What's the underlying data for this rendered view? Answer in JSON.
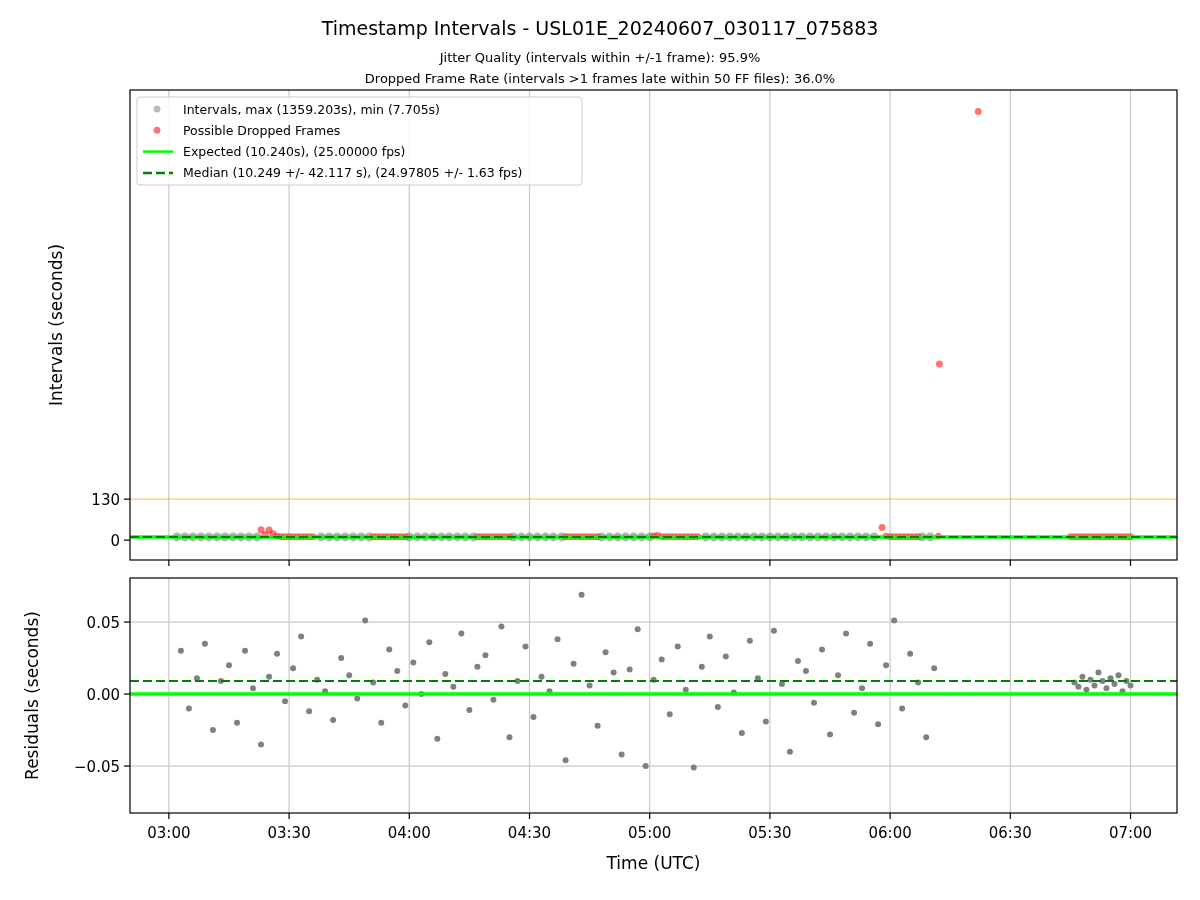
{
  "figure": {
    "title": "Timestamp Intervals - USL01E_20240607_030117_075883",
    "subtitles": [
      "Jitter Quality (intervals within +/-1 frame): 95.9%",
      "Dropped Frame Rate (intervals >1 frames late within 50 FF files): 36.0%"
    ]
  },
  "intervals_plot": {
    "chart_data": {
      "type": "scatter",
      "ylabel": "Intervals (seconds)",
      "xlim": [
        170.3,
        431.6
      ],
      "ylim": [
        -63,
        1427
      ],
      "yticks": [
        {
          "value": 0,
          "label": "0"
        },
        {
          "value": 130,
          "label": "130"
        }
      ],
      "series": [
        {
          "name": "Intervals, max (1359.203s), min (7.705s)",
          "type": "scatter",
          "color": "#808080",
          "x": [
            182,
            184,
            186,
            188,
            190,
            192,
            194,
            196,
            198,
            200,
            202,
            218,
            220,
            222,
            224,
            226,
            228,
            230,
            240,
            242,
            244,
            246,
            248,
            250,
            252,
            254,
            256,
            266,
            268,
            270,
            272,
            274,
            276,
            278,
            288,
            290,
            292,
            294,
            296,
            298,
            300,
            314,
            316,
            318,
            320,
            322,
            324,
            326,
            328,
            330,
            332,
            334,
            336,
            338,
            340,
            342,
            344,
            346,
            348,
            350,
            352,
            354,
            356,
            368,
            370
          ],
          "values": [
            10.2,
            10.2,
            10.2,
            10.2,
            10.2,
            10.2,
            10.2,
            10.2,
            10.2,
            10.2,
            10.2,
            10.2,
            10.2,
            10.2,
            10.2,
            10.2,
            10.2,
            10.2,
            10.2,
            10.2,
            10.2,
            10.2,
            10.2,
            10.2,
            10.2,
            10.2,
            10.2,
            10.2,
            10.2,
            10.2,
            10.2,
            10.2,
            10.2,
            10.2,
            10.2,
            10.2,
            10.2,
            10.2,
            10.2,
            10.2,
            10.2,
            10.2,
            10.2,
            10.2,
            10.2,
            10.2,
            10.2,
            10.2,
            10.2,
            10.2,
            10.2,
            10.2,
            10.2,
            10.2,
            10.2,
            10.2,
            10.2,
            10.2,
            10.2,
            10.2,
            10.2,
            10.2,
            10.2,
            10.2,
            10.2
          ]
        },
        {
          "name": "Possible Dropped Frames",
          "type": "scatter",
          "color": "#ff0000",
          "x": [
            203,
            204,
            205,
            206,
            207,
            208,
            209,
            210,
            211,
            212,
            213,
            214,
            215,
            216,
            231,
            232,
            233,
            234,
            235,
            236,
            237,
            238,
            239,
            257,
            258,
            259,
            260,
            261,
            262,
            263,
            264,
            265,
            279,
            280,
            281,
            282,
            283,
            284,
            285,
            286,
            287,
            301,
            302,
            303,
            304,
            305,
            306,
            307,
            308,
            309,
            310,
            311,
            312,
            358,
            359,
            360,
            361,
            362,
            363,
            364,
            365,
            366,
            367,
            372,
            372.3,
            382,
            405,
            406,
            407,
            408,
            409,
            410,
            411,
            412,
            413,
            414,
            415,
            416,
            417,
            418,
            419,
            420
          ],
          "values": [
            33,
            18,
            32,
            20,
            12,
            10.5,
            10.5,
            10.5,
            10.5,
            10.5,
            10.5,
            10.5,
            10.5,
            10.5,
            10.5,
            10.5,
            10.5,
            10.5,
            10.5,
            10.5,
            10.5,
            10.5,
            10.5,
            10.5,
            10.5,
            10.5,
            10.5,
            10.5,
            10.5,
            10.5,
            10.5,
            10.5,
            10.5,
            10.5,
            10.5,
            10.5,
            10.5,
            10.5,
            10.5,
            10.5,
            10.5,
            13,
            15,
            10.5,
            10.5,
            10.5,
            10.5,
            10.5,
            10.5,
            10.5,
            10.5,
            10.5,
            10.5,
            40,
            12,
            10.5,
            10.5,
            10.5,
            10.5,
            10.5,
            10.5,
            10.5,
            10.5,
            12,
            558,
            1359,
            10.5,
            10.5,
            10.5,
            10.5,
            10.5,
            10.5,
            10.5,
            10.5,
            10.5,
            10.5,
            10.5,
            10.5,
            10.5,
            10.5,
            10.5,
            10.5
          ]
        },
        {
          "name": "Expected (10.240s), (25.00000 fps)",
          "type": "line",
          "color": "#00ff00",
          "x": [
            170.3,
            431.6
          ],
          "values": [
            10.24,
            10.24
          ]
        },
        {
          "name": "Median (10.249 +/- 42.117 s), (24.97805 +/- 1.63 fps)",
          "type": "line",
          "line_style": "dashed",
          "color": "#008000",
          "x": [
            170.3,
            431.6
          ],
          "values": [
            10.249,
            10.249
          ]
        }
      ],
      "ref_lines": [
        {
          "axis": "y",
          "value": 130,
          "color": "#ffa500"
        }
      ],
      "grid": "x",
      "legend": true
    }
  },
  "residuals_plot": {
    "chart_data": {
      "type": "scatter",
      "xlabel": "Time (UTC)",
      "ylabel": "Residuals (seconds)",
      "xlim": [
        170.3,
        431.6
      ],
      "ylim": [
        -0.0826,
        0.0806
      ],
      "xticks": [
        {
          "value": 180,
          "label": "03:00"
        },
        {
          "value": 210,
          "label": "03:30"
        },
        {
          "value": 240,
          "label": "04:00"
        },
        {
          "value": 270,
          "label": "04:30"
        },
        {
          "value": 300,
          "label": "05:00"
        },
        {
          "value": 330,
          "label": "05:30"
        },
        {
          "value": 360,
          "label": "06:00"
        },
        {
          "value": 390,
          "label": "06:30"
        },
        {
          "value": 420,
          "label": "07:00"
        }
      ],
      "yticks": [
        {
          "value": -0.05,
          "label": "−0.05"
        },
        {
          "value": 0,
          "label": "0.00"
        },
        {
          "value": 0.05,
          "label": "0.05"
        }
      ],
      "series": [
        {
          "type": "scatter",
          "color": "#808080",
          "x": [
            183,
            185,
            187,
            189,
            191,
            193,
            195,
            197,
            199,
            201,
            203,
            205,
            207,
            209,
            211,
            213,
            215,
            217,
            219,
            221,
            223,
            225,
            227,
            229,
            231,
            233,
            235,
            237,
            239,
            241,
            243,
            245,
            247,
            249,
            251,
            253,
            255,
            257,
            259,
            261,
            263,
            265,
            267,
            269,
            271,
            273,
            275,
            277,
            279,
            281,
            283,
            285,
            287,
            289,
            291,
            293,
            295,
            297,
            299,
            301,
            303,
            305,
            307,
            309,
            311,
            313,
            315,
            317,
            319,
            321,
            323,
            325,
            327,
            329,
            331,
            333,
            335,
            337,
            339,
            341,
            343,
            345,
            347,
            349,
            351,
            353,
            355,
            357,
            359,
            361,
            363,
            365,
            367,
            369,
            371,
            406,
            407,
            408,
            409,
            410,
            411,
            412,
            413,
            414,
            415,
            416,
            417,
            418,
            419,
            420
          ],
          "values": [
            0.03,
            -0.01,
            0.011,
            0.035,
            -0.025,
            0.009,
            0.02,
            -0.02,
            0.03,
            0.004,
            -0.035,
            0.012,
            0.028,
            -0.005,
            0.018,
            0.04,
            -0.012,
            0.01,
            0.002,
            -0.018,
            0.025,
            0.013,
            -0.003,
            0.051,
            0.008,
            -0.02,
            0.031,
            0.016,
            -0.008,
            0.022,
            0.0,
            0.036,
            -0.031,
            0.014,
            0.005,
            0.042,
            -0.011,
            0.019,
            0.027,
            -0.004,
            0.047,
            -0.03,
            0.009,
            0.033,
            -0.016,
            0.012,
            0.002,
            0.038,
            -0.046,
            0.021,
            0.069,
            0.006,
            -0.022,
            0.029,
            0.015,
            -0.042,
            0.017,
            0.045,
            -0.05,
            0.01,
            0.024,
            -0.014,
            0.033,
            0.003,
            -0.051,
            0.019,
            0.04,
            -0.009,
            0.026,
            0.001,
            -0.027,
            0.037,
            0.011,
            -0.019,
            0.044,
            0.007,
            -0.04,
            0.023,
            0.016,
            -0.006,
            0.031,
            -0.028,
            0.013,
            0.042,
            -0.013,
            0.004,
            0.035,
            -0.021,
            0.02,
            0.051,
            -0.01,
            0.028,
            0.008,
            -0.03,
            0.018,
            0.008,
            0.005,
            0.012,
            0.003,
            0.01,
            0.006,
            0.015,
            0.009,
            0.004,
            0.011,
            0.007,
            0.013,
            0.002,
            0.009,
            0.006
          ]
        },
        {
          "type": "line",
          "color": "#00ff00",
          "x": [
            170.3,
            431.6
          ],
          "values": [
            0,
            0
          ]
        },
        {
          "type": "line",
          "line_style": "dashed",
          "color": "#008000",
          "x": [
            170.3,
            431.6
          ],
          "values": [
            0.009,
            0.009
          ]
        }
      ],
      "grid": "both"
    }
  }
}
